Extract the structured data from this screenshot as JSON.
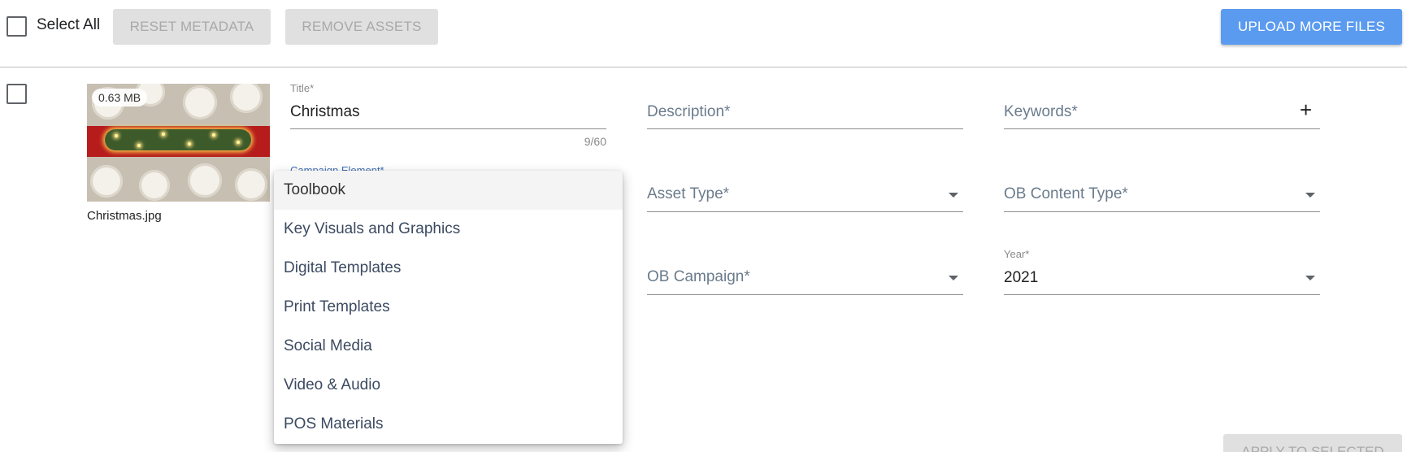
{
  "toolbar": {
    "select_all_label": "Select All",
    "reset_label": "RESET METADATA",
    "remove_label": "REMOVE ASSETS",
    "upload_label": "UPLOAD MORE FILES"
  },
  "asset": {
    "size": "0.63 MB",
    "filename": "Christmas.jpg",
    "title_label": "Title*",
    "title_value": "Christmas",
    "title_counter": "9/60",
    "description_placeholder": "Description*",
    "keywords_placeholder": "Keywords*",
    "campaign_element_label": "Campaign Element*",
    "asset_type_placeholder": "Asset Type*",
    "ob_content_type_placeholder": "OB Content Type*",
    "ob_campaign_placeholder": "OB Campaign*",
    "year_label": "Year*",
    "year_value": "2021"
  },
  "dropdown": {
    "options": [
      "Toolbook",
      "Key Visuals and Graphics",
      "Digital Templates",
      "Print Templates",
      "Social Media",
      "Video & Audio",
      "POS Materials"
    ],
    "highlighted": "Toolbook"
  },
  "footer": {
    "apply_label": "APPLY TO SELECTED"
  },
  "colors": {
    "primary_button": "#5b9bef",
    "disabled_button": "#e0e0e0"
  },
  "icons": {
    "add_keyword": "plus-icon",
    "select_caret": "chevron-down-icon"
  }
}
